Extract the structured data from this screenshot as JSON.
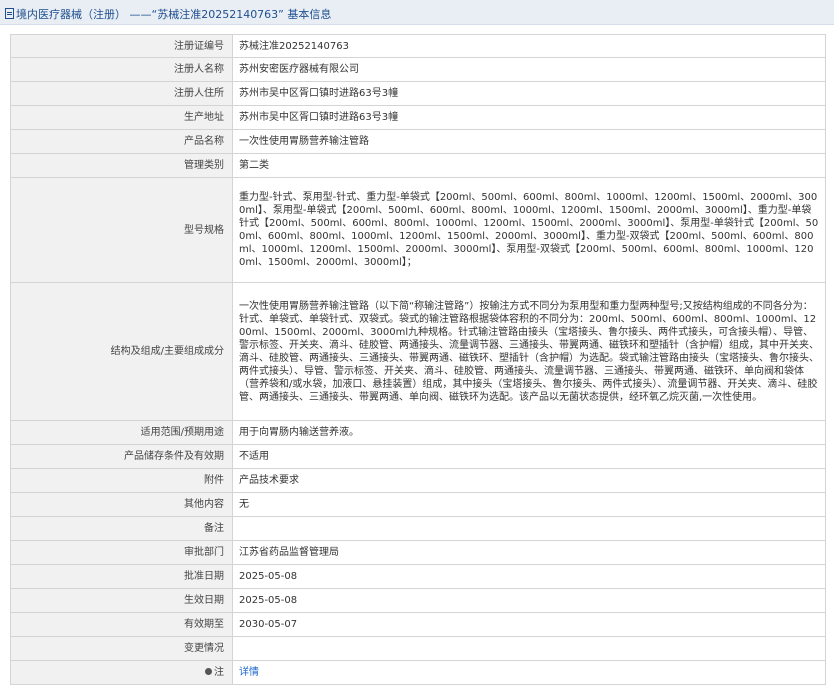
{
  "header": {
    "breadcrumb_category": "境内医疗器械（注册）",
    "separator": "——",
    "record_title": "“苏械注准20252140763”",
    "suffix": "基本信息"
  },
  "rows": [
    {
      "label": "注册证编号",
      "value": "苏械注准20252140763"
    },
    {
      "label": "注册人名称",
      "value": "苏州安密医疗器械有限公司"
    },
    {
      "label": "注册人住所",
      "value": "苏州市吴中区胥口镇时进路63号3幢"
    },
    {
      "label": "生产地址",
      "value": "苏州市吴中区胥口镇时进路63号3幢"
    },
    {
      "label": "产品名称",
      "value": "一次性使用胃肠营养输注管路"
    },
    {
      "label": "管理类别",
      "value": "第二类"
    },
    {
      "label": "型号规格",
      "value": "重力型-针式、泵用型-针式、重力型-单袋式【200ml、500ml、600ml、800ml、1000ml、1200ml、1500ml、2000ml、3000ml】、泵用型-单袋式【200ml、500ml、600ml、800ml、1000ml、1200ml、1500ml、2000ml、3000ml】、重力型-单袋针式【200ml、500ml、600ml、800ml、1000ml、1200ml、1500ml、2000ml、3000ml】、泵用型-单袋针式【200ml、500ml、600ml、800ml、1000ml、1200ml、1500ml、2000ml、3000ml】、重力型-双袋式【200ml、500ml、600ml、800ml、1000ml、1200ml、1500ml、2000ml、3000ml】、泵用型-双袋式【200ml、500ml、600ml、800ml、1000ml、1200ml、1500ml、2000ml、3000ml】；"
    },
    {
      "label": "结构及组成/主要组成成分",
      "value": "一次性使用胃肠营养输注管路（以下简“称输注管路”）按输注方式不同分为泵用型和重力型两种型号;又按结构组成的不同各分为：针式、单袋式、单袋针式、双袋式。袋式的输注管路根据袋体容积的不同分为：200ml、500ml、600ml、800ml、1000ml、1200ml、1500ml、2000ml、3000ml九种规格。针式输注管路由接头（宝塔接头、鲁尔接头、两件式接头，可含接头帽）、导管、警示标签、开关夹、滴斗、硅胶管、两通接头、流量调节器、三通接头、带翼两通、磁铁环和塑插针（含护帽）组成，其中开关夹、滴斗、硅胶管、两通接头、三通接头、带翼两通、磁铁环、塑插针（含护帽）为选配。袋式输注管路由接头（宝塔接头、鲁尔接头、两件式接头）、导管、警示标签、开关夹、滴斗、硅胶管、两通接头、流量调节器、三通接头、带翼两通、磁铁环、单向阀和袋体（营养袋和/或水袋，加液口、悬挂装置）组成，其中接头（宝塔接头、鲁尔接头、两件式接头）、流量调节器、开关夹、滴斗、硅胶管、两通接头、三通接头、带翼两通、单向阀、磁铁环为选配。该产品以无菌状态提供，经环氧乙烷灭菌,一次性使用。"
    },
    {
      "label": "适用范围/预期用途",
      "value": "用于向胃肠内输送营养液。"
    },
    {
      "label": "产品储存条件及有效期",
      "value": "不适用"
    },
    {
      "label": "附件",
      "value": "产品技术要求"
    },
    {
      "label": "其他内容",
      "value": "无"
    },
    {
      "label": "备注",
      "value": ""
    },
    {
      "label": "审批部门",
      "value": "江苏省药品监督管理局"
    },
    {
      "label": "批准日期",
      "value": "2025-05-08"
    },
    {
      "label": "生效日期",
      "value": "2025-05-08"
    },
    {
      "label": "有效期至",
      "value": "2030-05-07"
    },
    {
      "label": "变更情况",
      "value": ""
    }
  ],
  "note_row": {
    "label": "注",
    "icon": "info-dot-icon",
    "link_text": "详情"
  }
}
